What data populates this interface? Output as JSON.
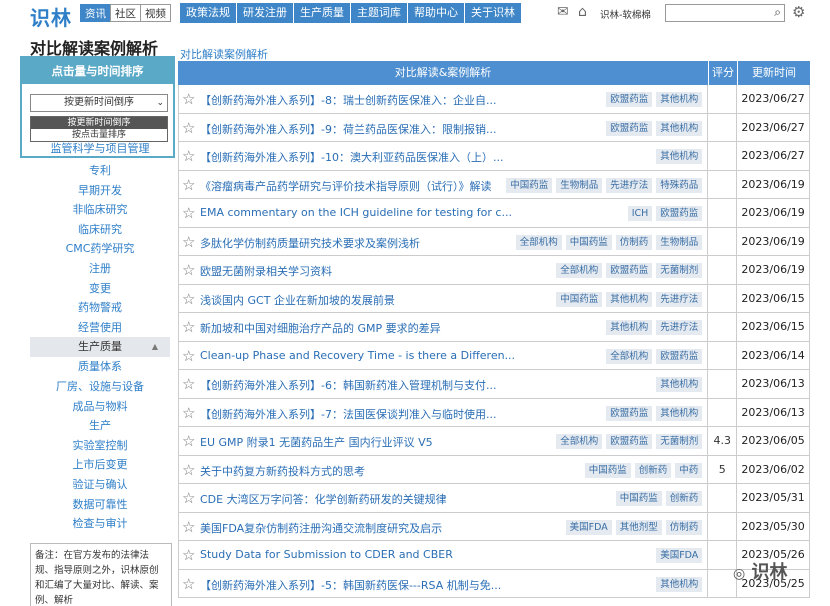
{
  "header": {
    "logo": "识林",
    "modes": [
      "资讯",
      "社区",
      "视频"
    ],
    "nav": [
      "政策法规",
      "研发注册",
      "生产质量",
      "主题词库",
      "帮助中心",
      "关于识林"
    ],
    "user": "识林-软棉棉",
    "search_placeholder": ""
  },
  "sidebar": {
    "page_title": "对比解读案例解析",
    "sort_title": "点击量与时间排序",
    "sort_selected": "按更新时间倒序",
    "sort_options": [
      "按更新时间倒序",
      "按点击量排序"
    ],
    "categories_a": [
      "监管科学与项目管理",
      "专利",
      "早期开发",
      "非临床研究",
      "临床研究",
      "CMC药学研究",
      "注册",
      "变更",
      "药物警戒",
      "经营使用"
    ],
    "section_header": "生产质量",
    "categories_b": [
      "质量体系",
      "厂房、设施与设备",
      "成品与物料",
      "生产",
      "实验室控制",
      "上市后变更",
      "验证与确认",
      "数据可靠性",
      "检查与审计"
    ],
    "note": "备注：在官方发布的法律法规、指导原则之外，识林原创和汇编了大量对比、解读、案例、解析"
  },
  "main": {
    "breadcrumb": "对比解读案例解析",
    "columns": [
      "对比解读&案例解析",
      "评分",
      "更新时间"
    ],
    "rows": [
      {
        "title": "【创新药海外准入系列】-8：瑞士创新药医保准入：企业自...",
        "tags": [
          "欧盟药监",
          "其他机构"
        ],
        "score": "",
        "date": "2023/06/27"
      },
      {
        "title": "【创新药海外准入系列】-9：荷兰药品医保准入：限制报销...",
        "tags": [
          "欧盟药监",
          "其他机构"
        ],
        "score": "",
        "date": "2023/06/27"
      },
      {
        "title": "【创新药海外准入系列】-10：澳大利亚药品医保准入（上）...",
        "tags": [
          "其他机构"
        ],
        "score": "",
        "date": "2023/06/27"
      },
      {
        "title": "《溶瘤病毒产品药学研究与评价技术指导原则（试行）》解读",
        "tags": [
          "中国药监",
          "生物制品",
          "先进疗法",
          "特殊药品"
        ],
        "score": "",
        "date": "2023/06/19"
      },
      {
        "title": "EMA commentary on the ICH guideline for testing for c...",
        "tags": [
          "ICH",
          "欧盟药监"
        ],
        "score": "",
        "date": "2023/06/19"
      },
      {
        "title": "多肽化学仿制药质量研究技术要求及案例浅析",
        "tags": [
          "全部机构",
          "中国药监",
          "仿制药",
          "生物制品"
        ],
        "score": "",
        "date": "2023/06/19"
      },
      {
        "title": "欧盟无菌附录相关学习资料",
        "tags": [
          "全部机构",
          "欧盟药监",
          "无菌制剂"
        ],
        "score": "",
        "date": "2023/06/19"
      },
      {
        "title": "浅谈国内 GCT 企业在新加坡的发展前景",
        "tags": [
          "中国药监",
          "其他机构",
          "先进疗法"
        ],
        "score": "",
        "date": "2023/06/15"
      },
      {
        "title": "新加坡和中国对细胞治疗产品的 GMP 要求的差异",
        "tags": [
          "其他机构",
          "先进疗法"
        ],
        "score": "",
        "date": "2023/06/15"
      },
      {
        "title": "Clean-up Phase and Recovery Time - is there a Differen...",
        "tags": [
          "全部机构",
          "欧盟药监"
        ],
        "score": "",
        "date": "2023/06/14"
      },
      {
        "title": "【创新药海外准入系列】-6：韩国新药准入管理机制与支付...",
        "tags": [
          "其他机构"
        ],
        "score": "",
        "date": "2023/06/13"
      },
      {
        "title": "【创新药海外准入系列】-7：法国医保谈判准入与临时使用...",
        "tags": [
          "欧盟药监",
          "其他机构"
        ],
        "score": "",
        "date": "2023/06/13"
      },
      {
        "title": "EU GMP 附录1 无菌药品生产 国内行业评议 V5",
        "tags": [
          "全部机构",
          "欧盟药监",
          "无菌制剂"
        ],
        "score": "4.3",
        "date": "2023/06/05"
      },
      {
        "title": "关于中药复方新药投料方式的思考",
        "tags": [
          "中国药监",
          "创新药",
          "中药"
        ],
        "score": "5",
        "date": "2023/06/02"
      },
      {
        "title": "CDE 大湾区万字问答：化学创新药研发的关键规律",
        "tags": [
          "中国药监",
          "创新药"
        ],
        "score": "",
        "date": "2023/05/31"
      },
      {
        "title": "美国FDA复杂仿制药注册沟通交流制度研究及启示",
        "tags": [
          "美国FDA",
          "其他剂型",
          "仿制药"
        ],
        "score": "",
        "date": "2023/05/30"
      },
      {
        "title": "Study Data for Submission to CDER and CBER",
        "tags": [
          "美国FDA"
        ],
        "score": "",
        "date": "2023/05/26"
      },
      {
        "title": "【创新药海外准入系列】-5：韩国新药医保---RSA 机制与免...",
        "tags": [
          "其他机构"
        ],
        "score": "",
        "date": "2023/05/25"
      }
    ]
  },
  "watermark": "识林"
}
